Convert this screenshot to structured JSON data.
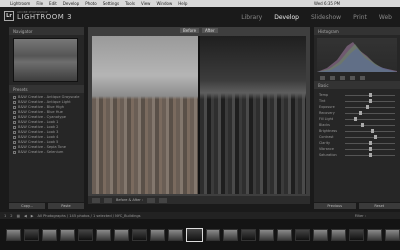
{
  "menubar": {
    "items": [
      "Lightroom",
      "File",
      "Edit",
      "Develop",
      "Photo",
      "Settings",
      "Tools",
      "View",
      "Window",
      "Help"
    ],
    "right": "Wed 6:35 PM"
  },
  "identity": {
    "badge": "Lr",
    "small": "ADOBE PHOTOSHOP",
    "title": "LIGHTROOM 3"
  },
  "modules": [
    {
      "label": "Library",
      "active": false
    },
    {
      "label": "Develop",
      "active": true
    },
    {
      "label": "Slideshow",
      "active": false
    },
    {
      "label": "Print",
      "active": false
    },
    {
      "label": "Web",
      "active": false
    }
  ],
  "navigator": {
    "title": "Navigator"
  },
  "presets": {
    "title": "Presets",
    "items": [
      "B&W Creative - Antique Grayscale",
      "B&W Creative - Antique Light",
      "B&W Creative - Blue High",
      "B&W Creative - Blue Hue",
      "B&W Creative - Cyanotype",
      "B&W Creative - Look 1",
      "B&W Creative - Look 2",
      "B&W Creative - Look 3",
      "B&W Creative - Look 4",
      "B&W Creative - Look 5",
      "B&W Creative - Sepia Tone",
      "B&W Creative - Selenium"
    ]
  },
  "left_buttons": {
    "copy": "Copy...",
    "paste": "Paste"
  },
  "view": {
    "before_label": "Before",
    "after_label": "After"
  },
  "toolbar": {
    "label": "Before & After :"
  },
  "histogram": {
    "title": "Histogram"
  },
  "basic": {
    "title": "Basic",
    "sliders": [
      {
        "label": "Temp",
        "value": 0.5
      },
      {
        "label": "Tint",
        "value": 0.5
      },
      {
        "label": "Exposure",
        "value": 0.45
      },
      {
        "label": "Recovery",
        "value": 0.3
      },
      {
        "label": "Fill Light",
        "value": 0.2
      },
      {
        "label": "Blacks",
        "value": 0.35
      },
      {
        "label": "Brightness",
        "value": 0.55
      },
      {
        "label": "Contrast",
        "value": 0.6
      },
      {
        "label": "Clarity",
        "value": 0.5
      },
      {
        "label": "Vibrance",
        "value": 0.5
      },
      {
        "label": "Saturation",
        "value": 0.5
      }
    ]
  },
  "right_buttons": {
    "previous": "Previous",
    "reset": "Reset"
  },
  "filmbar": {
    "pages": [
      "1",
      "2"
    ],
    "crumb": "All Photographs / 145 photos / 1 selected / NYC_Buildings",
    "filter": "Filter :"
  },
  "filmstrip_count": 22
}
